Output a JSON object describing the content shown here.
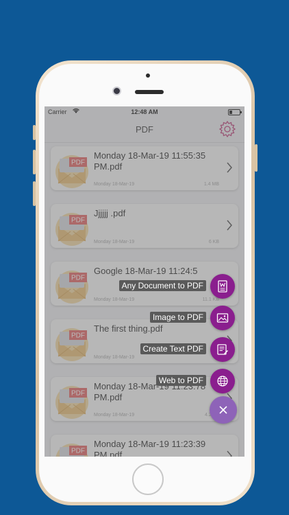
{
  "status_bar": {
    "carrier": "Carrier",
    "time": "12:48 AM"
  },
  "nav": {
    "title": "PDF",
    "settings_icon": "gear-icon"
  },
  "files": [
    {
      "title": "Monday 18-Mar-19 11:55:35 PM.pdf",
      "date": "Monday 18-Mar-19",
      "size": "1.4 MB",
      "badge": "PDF"
    },
    {
      "title": "Jjjjjj .pdf",
      "date": "Monday 18-Mar-19",
      "size": "6 KB",
      "badge": "PDF"
    },
    {
      "title": "Google 18-Mar-19 11:24:5",
      "date": "Monday 18-Mar-19",
      "size": "11.1 KB",
      "badge": "PDF"
    },
    {
      "title": "The first thing.pdf",
      "date": "Monday 18-Mar-19",
      "size": "",
      "badge": "PDF"
    },
    {
      "title": "Monday 18-Mar-19 11:23:78 PM.pdf",
      "date": "Monday 18-Mar-19",
      "size": "4.2 KB",
      "badge": "PDF"
    },
    {
      "title": "Monday 18-Mar-19 11:23:39 PM.pdf",
      "date": "",
      "size": "",
      "badge": "PDF"
    }
  ],
  "fab_menu": {
    "items": [
      {
        "label": "Any Document to PDF",
        "icon": "word-document-icon"
      },
      {
        "label": "Image to PDF",
        "icon": "image-icon"
      },
      {
        "label": "Create Text PDF",
        "icon": "text-document-icon"
      },
      {
        "label": "Web to PDF",
        "icon": "globe-icon"
      }
    ],
    "close_icon": "close-icon"
  },
  "colors": {
    "background": "#0d5896",
    "fab": "#8a1e8e",
    "fab_close": "#8e63b8",
    "pdf_badge": "#e06060",
    "accent": "#b84a9a"
  }
}
